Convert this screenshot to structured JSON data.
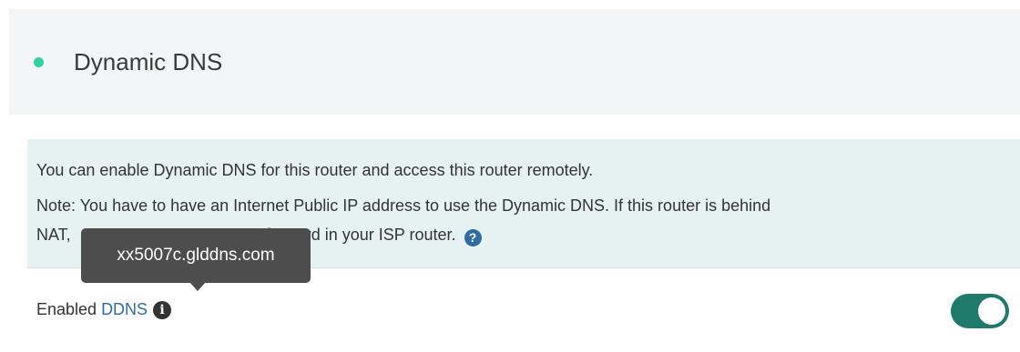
{
  "header": {
    "title": "Dynamic DNS",
    "status_color": "#2ed3a0"
  },
  "info": {
    "line1": "You can enable Dynamic DNS for this router and access this router remotely.",
    "line2": "Note: You have to have an Internet Public IP address to use the Dynamic DNS. If this router is behind",
    "line3_start": "NAT,",
    "line3_end": "port forward in your ISP router.",
    "help_icon": "question-circle-icon"
  },
  "tooltip": {
    "text": "xx5007c.glddns.com"
  },
  "setting": {
    "label_prefix": "Enabled",
    "label_link": "DDNS",
    "info_icon": "info-circle-icon",
    "toggle_on": true,
    "toggle_color": "#1f7a6c"
  }
}
